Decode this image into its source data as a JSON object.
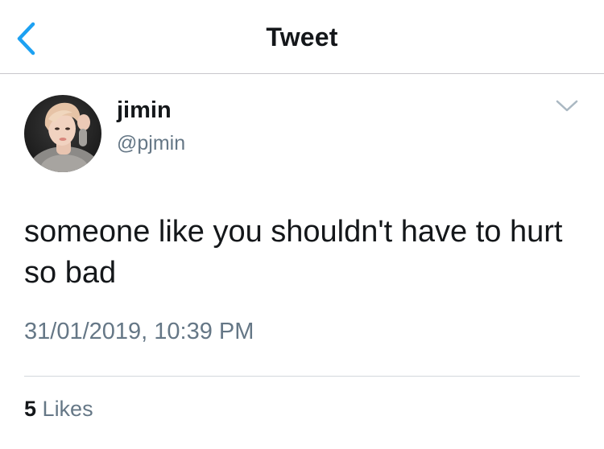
{
  "nav": {
    "title": "Tweet",
    "back_icon": "chevron-left-icon",
    "accent_color": "#1da1f2"
  },
  "tweet": {
    "author": {
      "display_name": "jimin",
      "handle": "@pjmin",
      "avatar": "avatar-photo"
    },
    "more_icon": "chevron-down-icon",
    "text": "someone like you shouldn't have to hurt so bad",
    "timestamp": "31/01/2019, 10:39 PM",
    "likes": {
      "count": "5",
      "label": "Likes"
    }
  },
  "colors": {
    "primary_text": "#14171a",
    "secondary_text": "#657786",
    "divider": "#d3d8dc"
  }
}
